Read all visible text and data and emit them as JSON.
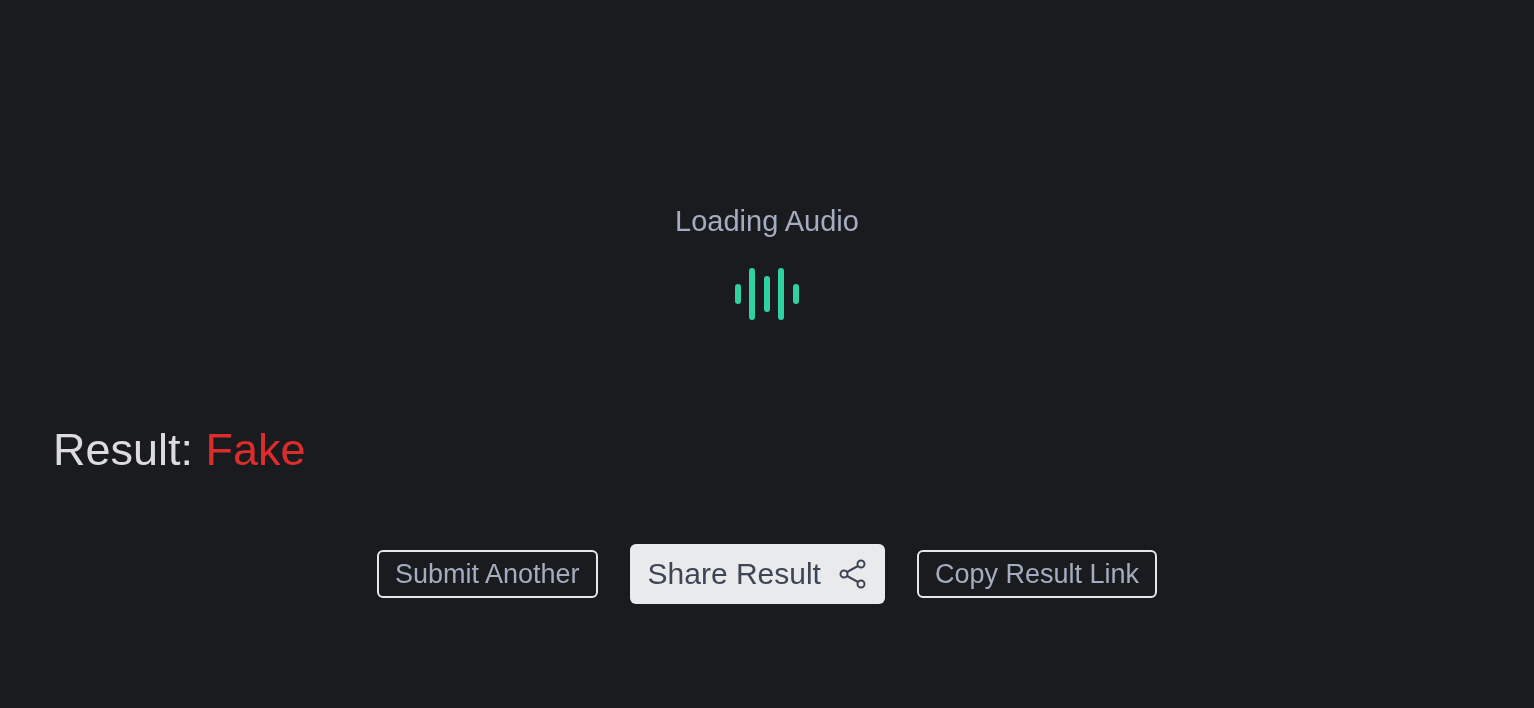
{
  "loader": {
    "title": "Loading Audio"
  },
  "result": {
    "label": "Result:",
    "verdict": "Fake"
  },
  "buttons": [
    {
      "label": "Submit Another",
      "kind": "outline"
    },
    {
      "label": "Share Result",
      "kind": "share"
    },
    {
      "label": "Copy Result Link",
      "kind": "outline"
    }
  ]
}
